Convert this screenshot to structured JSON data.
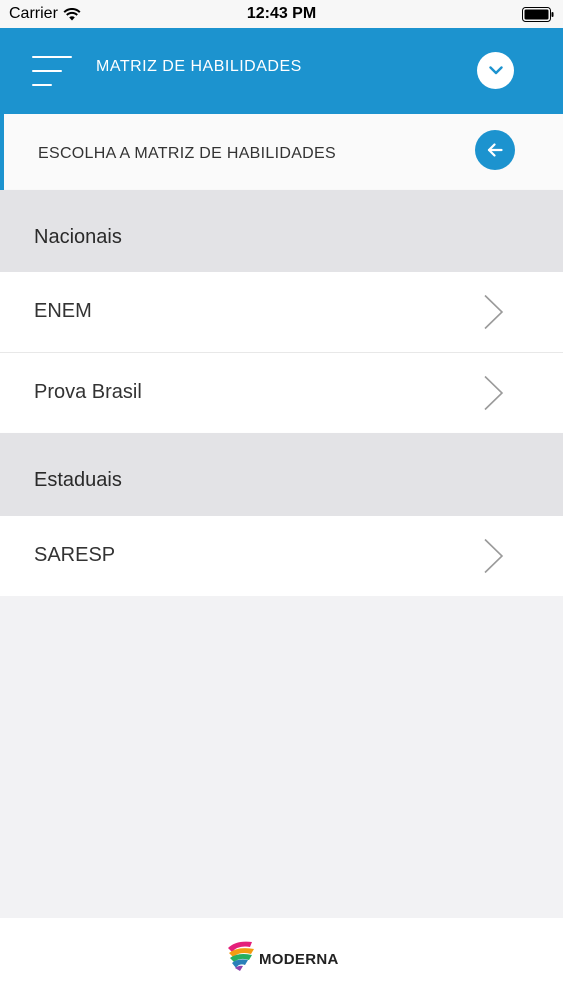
{
  "status_bar": {
    "carrier": "Carrier",
    "time": "12:43 PM"
  },
  "header": {
    "title": "MATRIZ DE HABILIDADES",
    "menu_icon": "hamburger-menu-icon",
    "dropdown_icon": "chevron-down-icon",
    "color": "#1c93cf"
  },
  "subheader": {
    "title": "ESCOLHA A MATRIZ DE HABILIDADES",
    "back_icon": "arrow-left-icon"
  },
  "sections": [
    {
      "title": "Nacionais",
      "items": [
        "ENEM",
        "Prova Brasil"
      ]
    },
    {
      "title": "Estaduais",
      "items": [
        "SARESP"
      ]
    }
  ],
  "footer": {
    "logo_text": "MODERNA"
  }
}
